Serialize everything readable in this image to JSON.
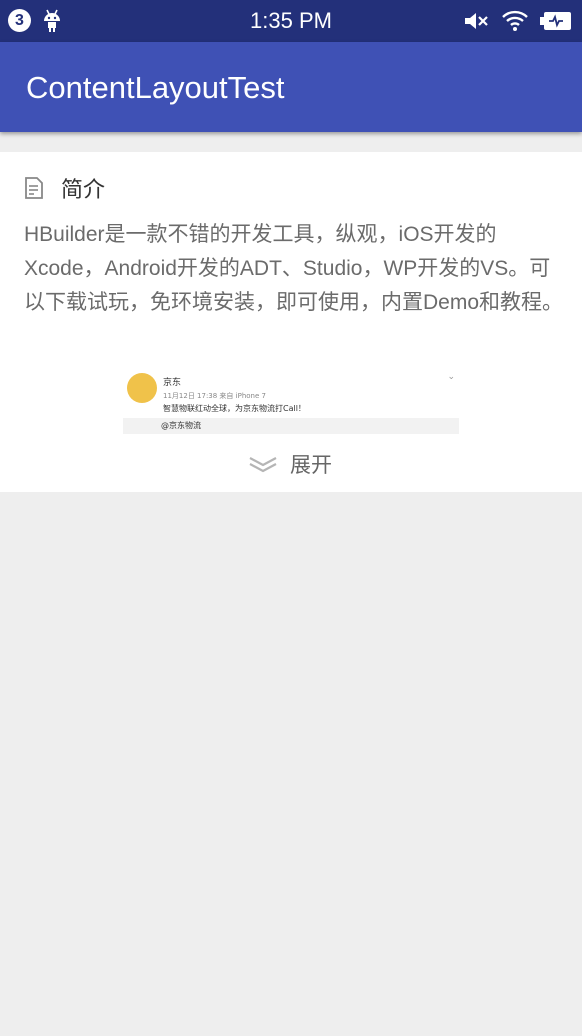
{
  "status_bar": {
    "notification_count": "3",
    "time": "1:35 PM"
  },
  "app_bar": {
    "title": "ContentLayoutTest"
  },
  "card": {
    "section_title": "简介",
    "content": " HBuilder是一款不错的开发工具，纵观，iOS开发的Xcode，Android开发的ADT、Studio，WP开发的VS。可以下载试玩，免环境安装，即可使用，内置Demo和教程。",
    "preview": {
      "name": "京东",
      "meta": "11月12日 17:38 来自 iPhone 7",
      "text": "智慧物联红动全球，为京东物流打Call！",
      "repost": "@京东物流"
    },
    "expand_label": "展开"
  },
  "colors": {
    "status_bar": "#23307a",
    "app_bar": "#3f51b5",
    "background": "#eeeeee"
  },
  "icons": [
    "android-icon",
    "mute-icon",
    "wifi-icon",
    "battery-icon",
    "document-icon",
    "expand-chevron-icon"
  ]
}
